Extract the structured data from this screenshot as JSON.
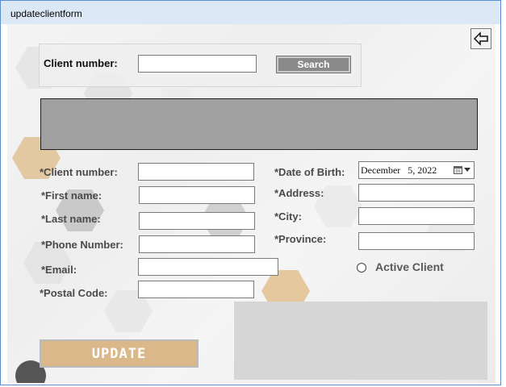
{
  "window": {
    "title": "updateclientform"
  },
  "search": {
    "label": "Client number:",
    "value": "",
    "button_label": "Search"
  },
  "results_grid": {},
  "form": {
    "client_number_label": "*Client number:",
    "first_name_label": "*First name:",
    "last_name_label": "*Last name:",
    "phone_label": "*Phone Number:",
    "email_label": "*Email:",
    "postal_code_label": "*Postal Code:",
    "dob_label": "*Date of Birth:",
    "address_label": "*Address:",
    "city_label": "*City:",
    "province_label": "*Province:",
    "dob_value": "December   5, 2022",
    "active_client_label": "Active Client",
    "update_button_label": "UPDATE"
  },
  "icons": {
    "back": "back-arrow-icon",
    "calendar": "calendar-icon",
    "dropdown": "chevron-down-icon"
  }
}
